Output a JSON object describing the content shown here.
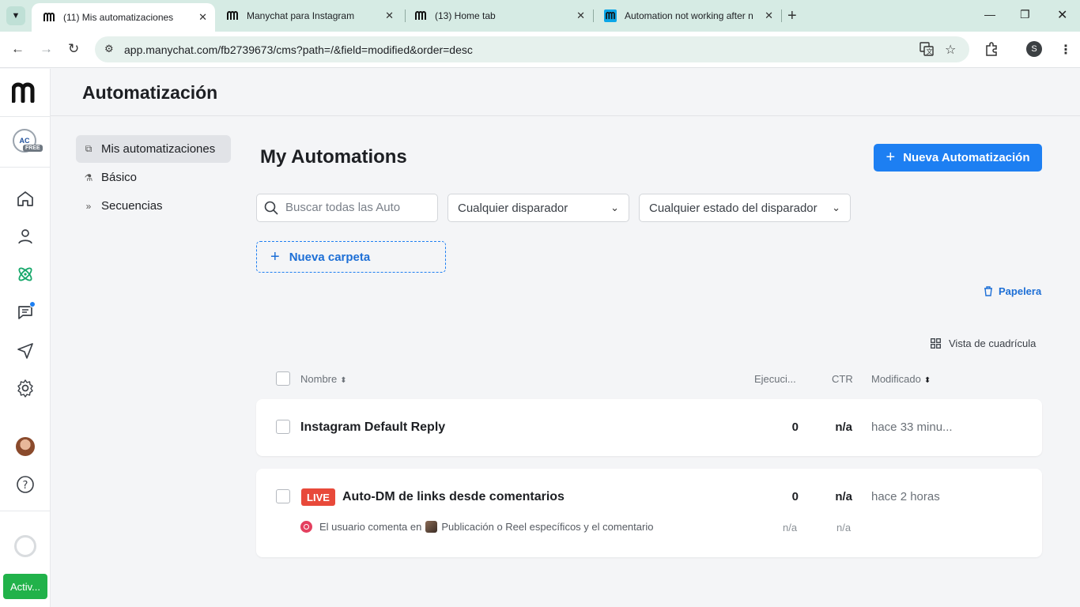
{
  "browser": {
    "tabs": [
      {
        "title": "(11) Mis automatizaciones",
        "active": true
      },
      {
        "title": "Manychat para Instagram",
        "active": false
      },
      {
        "title": "(13) Home tab",
        "active": false
      },
      {
        "title": "Automation not working after n",
        "active": false
      }
    ],
    "url": "app.manychat.com/fb2739673/cms?path=/&field=modified&order=desc",
    "profile_initial": "S"
  },
  "rail": {
    "account_label": "AC",
    "plan_badge": "FREE",
    "activate_label": "Activ...",
    "icons": [
      "home-icon",
      "contacts-icon",
      "automation-icon",
      "chat-icon",
      "broadcast-icon",
      "settings-icon",
      "help-icon"
    ]
  },
  "header": {
    "title": "Automatización"
  },
  "subnav": {
    "items": [
      {
        "label": "Mis automatizaciones",
        "icon": "flow-icon",
        "active": true
      },
      {
        "label": "Básico",
        "icon": "basic-icon",
        "active": false
      },
      {
        "label": "Secuencias",
        "icon": "sequence-icon",
        "active": false
      }
    ]
  },
  "main": {
    "title": "My Automations",
    "new_button": "Nueva Automatización",
    "search_placeholder": "Buscar todas las Auto",
    "trigger_filter": "Cualquier disparador",
    "status_filter": "Cualquier estado del disparador",
    "new_folder": "Nueva carpeta",
    "trash": "Papelera",
    "grid_view": "Vista de cuadrícula",
    "columns": {
      "name": "Nombre",
      "runs": "Ejecuci...",
      "ctr": "CTR",
      "modified": "Modificado"
    },
    "rows": [
      {
        "name": "Instagram Default Reply",
        "live": false,
        "runs": "0",
        "ctr": "n/a",
        "modified": "hace 33 minu..."
      },
      {
        "name": "Auto-DM de links desde comentarios",
        "live": true,
        "live_label": "LIVE",
        "runs": "0",
        "ctr": "n/a",
        "modified": "hace 2 horas",
        "trigger_prefix": "El usuario comenta en",
        "trigger_text": "Publicación o Reel específicos y el comentario",
        "trigger_runs": "n/a",
        "trigger_ctr": "n/a"
      }
    ]
  },
  "colors": {
    "accent": "#1d7ff2",
    "live": "#e8493a",
    "activate": "#21b24a"
  }
}
